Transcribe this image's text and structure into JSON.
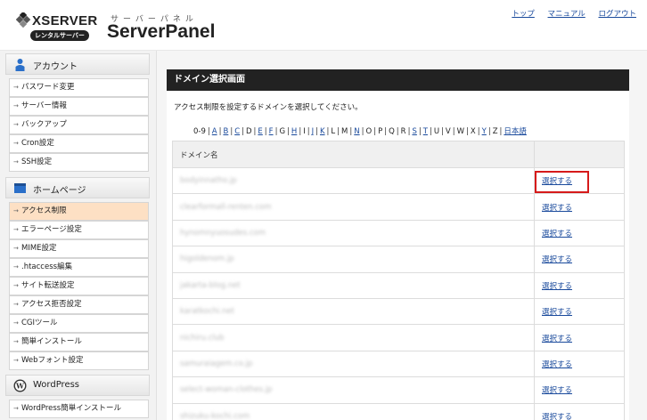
{
  "header": {
    "brand": "XSERVER",
    "rental_badge": "レンタルサーバー",
    "panel_kana": "サーバーパネル",
    "panel_title": "ServerPanel",
    "links": [
      "トップ",
      "マニュアル",
      "ログアウト"
    ]
  },
  "sidebar": {
    "sections": [
      {
        "title": "アカウント",
        "icon": "user-icon",
        "items": [
          "パスワード変更",
          "サーバー情報",
          "バックアップ",
          "Cron設定",
          "SSH設定"
        ]
      },
      {
        "title": "ホームページ",
        "icon": "homepage-icon",
        "items": [
          "アクセス制限",
          "エラーページ設定",
          "MIME設定",
          ".htaccess編集",
          "サイト転送設定",
          "アクセス拒否設定",
          "CGIツール",
          "簡単インストール",
          "Webフォント設定"
        ],
        "active_index": 0
      },
      {
        "title": "WordPress",
        "icon": "wordpress-icon",
        "items": [
          "WordPress簡単インストール"
        ]
      }
    ]
  },
  "main": {
    "title": "ドメイン選択画面",
    "description": "アクセス制限を設定するドメインを選択してください。",
    "alphabet_index": [
      "0-9",
      "A",
      "B",
      "C",
      "D",
      "E",
      "F",
      "G",
      "H",
      "I",
      "J",
      "K",
      "L",
      "M",
      "N",
      "O",
      "P",
      "Q",
      "R",
      "S",
      "T",
      "U",
      "V",
      "W",
      "X",
      "Y",
      "Z",
      "日本語"
    ],
    "alphabet_linked": [
      "A",
      "B",
      "C",
      "E",
      "F",
      "H",
      "J",
      "K",
      "N",
      "S",
      "T",
      "Y",
      "日本語"
    ],
    "table": {
      "column_domain": "ドメイン名",
      "action_label": "選択する",
      "rows": [
        "bodyinnatho.jp",
        "clearformall-renten.com",
        "hynomnyuosudes.com",
        "higoldenom.jp",
        "jakarta-blog.net",
        "karatkochi.net",
        "nichiru.club",
        "samuraiagem.co.jp",
        "select-woman-clothes.jp",
        "shizuku-kochi.com"
      ],
      "highlighted_row": 0
    },
    "accent_color": "#d61a1a"
  }
}
